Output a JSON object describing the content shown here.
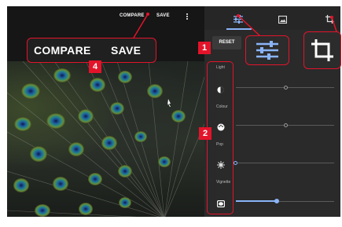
{
  "header": {
    "compare_label": "COMPARE",
    "save_label": "SAVE",
    "more_icon": "more-vert-icon"
  },
  "callout_compare_save": {
    "compare_label": "COMPARE",
    "save_label": "SAVE",
    "badge": "4"
  },
  "tabs": [
    {
      "name": "adjustments",
      "icon": "tune-icon",
      "active": true
    },
    {
      "name": "filters",
      "icon": "image-icon",
      "active": false
    },
    {
      "name": "crop",
      "icon": "crop-icon",
      "active": false
    }
  ],
  "reset_label": "RESET",
  "badges": {
    "tune": "1",
    "adjustments": "2"
  },
  "adjustments": [
    {
      "label": "Light",
      "icon": "brightness-icon",
      "value": 0.45
    },
    {
      "label": "Colour",
      "icon": "palette-icon",
      "value": 0.45
    },
    {
      "label": "Pop",
      "icon": "pop-icon",
      "value": 0.0
    },
    {
      "label": "Vignette",
      "icon": "vignette-icon",
      "value": 0.33
    }
  ],
  "colors": {
    "accent": "#e3142a",
    "slider_active": "#8ab4f8"
  }
}
